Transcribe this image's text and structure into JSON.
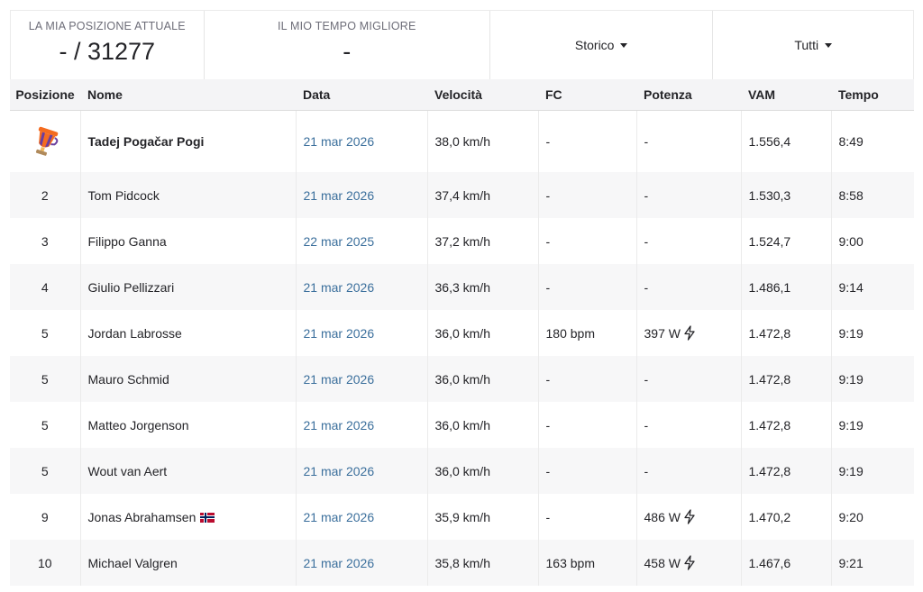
{
  "stats": {
    "position_label": "LA MIA POSIZIONE ATTUALE",
    "position_value": "- / 31277",
    "best_time_label": "IL MIO TEMPO MIGLIORE",
    "best_time_value": "-"
  },
  "filters": {
    "history_label": "Storico",
    "group_label": "Tutti"
  },
  "columns": {
    "position": "Posizione",
    "name": "Nome",
    "date": "Data",
    "speed": "Velocità",
    "heart_rate": "FC",
    "power": "Potenza",
    "vam": "VAM",
    "time": "Tempo"
  },
  "rows": [
    {
      "position": "",
      "name": "Tadej Pogačar Pogi",
      "date": "21 mar 2026",
      "speed": "38,0 km/h",
      "heart_rate": "-",
      "power": "-",
      "vam": "1.556,4",
      "time": "8:49"
    },
    {
      "position": "2",
      "name": "Tom Pidcock",
      "date": "21 mar 2026",
      "speed": "37,4 km/h",
      "heart_rate": "-",
      "power": "-",
      "vam": "1.530,3",
      "time": "8:58"
    },
    {
      "position": "3",
      "name": "Filippo Ganna",
      "date": "22 mar 2025",
      "speed": "37,2 km/h",
      "heart_rate": "-",
      "power": "-",
      "vam": "1.524,7",
      "time": "9:00"
    },
    {
      "position": "4",
      "name": "Giulio Pellizzari",
      "date": "21 mar 2026",
      "speed": "36,3 km/h",
      "heart_rate": "-",
      "power": "-",
      "vam": "1.486,1",
      "time": "9:14"
    },
    {
      "position": "5",
      "name": "Jordan Labrosse",
      "date": "21 mar 2026",
      "speed": "36,0 km/h",
      "heart_rate": "180 bpm",
      "power": "397 W",
      "vam": "1.472,8",
      "time": "9:19"
    },
    {
      "position": "5",
      "name": "Mauro Schmid",
      "date": "21 mar 2026",
      "speed": "36,0 km/h",
      "heart_rate": "-",
      "power": "-",
      "vam": "1.472,8",
      "time": "9:19"
    },
    {
      "position": "5",
      "name": "Matteo Jorgenson",
      "date": "21 mar 2026",
      "speed": "36,0 km/h",
      "heart_rate": "-",
      "power": "-",
      "vam": "1.472,8",
      "time": "9:19"
    },
    {
      "position": "5",
      "name": "Wout van Aert",
      "date": "21 mar 2026",
      "speed": "36,0 km/h",
      "heart_rate": "-",
      "power": "-",
      "vam": "1.472,8",
      "time": "9:19"
    },
    {
      "position": "9",
      "name": "Jonas Abrahamsen",
      "date": "21 mar 2026",
      "speed": "35,9 km/h",
      "heart_rate": "-",
      "power": "486 W",
      "vam": "1.470,2",
      "time": "9:20"
    },
    {
      "position": "10",
      "name": "Michael Valgren",
      "date": "21 mar 2026",
      "speed": "35,8 km/h",
      "heart_rate": "163 bpm",
      "power": "458 W",
      "vam": "1.467,6",
      "time": "9:21"
    }
  ],
  "icons": {
    "first_place": "trophy-icon",
    "power_meter": "lightning-bolt-icon",
    "flag": "norway-flag-icon",
    "dropdown": "caret-down-icon"
  },
  "colors": {
    "date_link": "#3b6f9c",
    "header_background": "#f4f4f6",
    "trophy_orange": "#f46b1f",
    "trophy_purple": "#6a3e9e"
  }
}
